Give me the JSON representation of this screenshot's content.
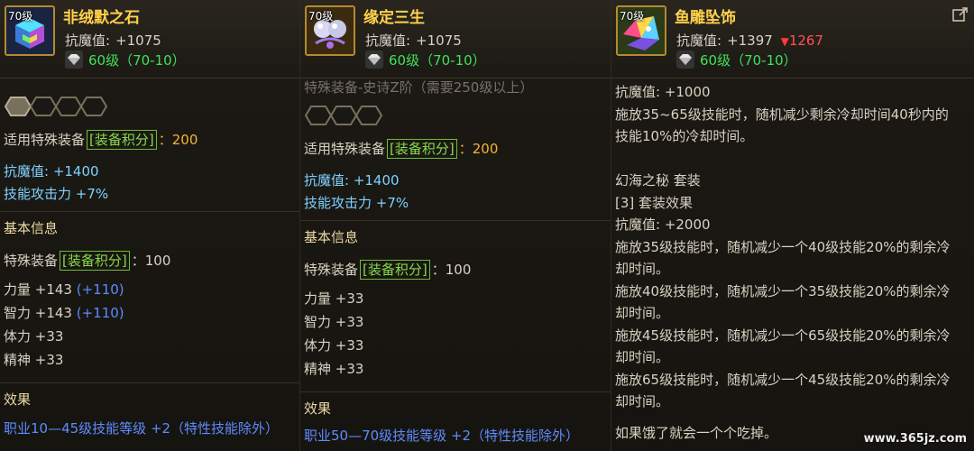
{
  "cards": [
    {
      "name": "非绒默之石",
      "level_tag": "70级",
      "magic_res_label": "抗魔值:",
      "magic_res_value": "+1075",
      "level_text": "60级（70-10）",
      "set_bonus_label": "适用特殊装备",
      "score_tag": "[装备积分]",
      "score_value": "：200",
      "bonus_mres": "抗魔值: +1400",
      "bonus_skill_atk": "技能攻击力 +7%",
      "basic_info": "基本信息",
      "special_label": "特殊装备",
      "special_score": "：100",
      "stats": [
        {
          "text": "力量 +143",
          "extra": "(+110)"
        },
        {
          "text": "智力 +143",
          "extra": "(+110)"
        },
        {
          "text": "体力 +33",
          "extra": ""
        },
        {
          "text": "精神 +33",
          "extra": ""
        }
      ],
      "effect_title": "效果",
      "effect_text": "职业10—45级技能等级 +2（特性技能除外）"
    },
    {
      "name": "缘定三生",
      "level_tag": "70级",
      "magic_res_label": "抗魔值:",
      "magic_res_value": "+1075",
      "level_text": "60级（70-10）",
      "faded_line": "特殊装备-史诗Z阶（需要250级以上）",
      "set_bonus_label": "适用特殊装备",
      "score_tag": "[装备积分]",
      "score_value": "：200",
      "bonus_mres": "抗魔值: +1400",
      "bonus_skill_atk": "技能攻击力 +7%",
      "basic_info": "基本信息",
      "special_label": "特殊装备",
      "special_score": "：100",
      "stats": [
        {
          "text": "力量 +33",
          "extra": ""
        },
        {
          "text": "智力 +33",
          "extra": ""
        },
        {
          "text": "体力 +33",
          "extra": ""
        },
        {
          "text": "精神 +33",
          "extra": ""
        }
      ],
      "effect_title": "效果",
      "effect_text": "职业50—70级技能等级 +2（特性技能除外）"
    },
    {
      "name": "鱼雕坠饰",
      "level_tag": "70级",
      "magic_res_label": "抗魔值:",
      "magic_res_value": "+1397",
      "magic_res_diff": "1267",
      "level_text": "60级（70-10）",
      "lines": [
        "抗魔值: +1000",
        "施放35~65级技能时，随机减少剩余冷却时间40秒内的",
        "技能10%的冷却时间。",
        "",
        "幻海之秘  套装",
        "[3] 套装效果",
        "抗魔值: +2000",
        "施放35级技能时，随机减少一个40级技能20%的剩余冷",
        "却时间。",
        "施放40级技能时，随机减少一个35级技能20%的剩余冷",
        "却时间。",
        "施放45级技能时，随机减少一个65级技能20%的剩余冷",
        "却时间。",
        "施放65级技能时，随机减少一个45级技能20%的剩余冷",
        "却时间。",
        "",
        "如果饿了就会一个个吃掉。"
      ]
    }
  ],
  "watermark": "www.365jz.com",
  "colors": {
    "name": "#ffd24a",
    "level": "#3fe15a",
    "cyan": "#7fd1ff",
    "blue": "#5e8bff",
    "gold": "#f2b531",
    "down": "#ff5151"
  }
}
